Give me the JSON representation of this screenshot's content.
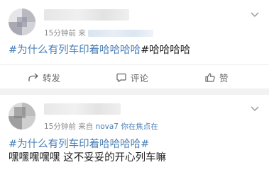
{
  "posts": [
    {
      "time": "15分钟前",
      "source_prefix": "来",
      "content_tag": "#为什么有列车印着哈哈哈哈",
      "content_text": "#哈哈哈哈",
      "actions": {
        "repost_label": "转发",
        "comment_label": "评论",
        "like_label": "赞"
      }
    },
    {
      "time": "15分钟前",
      "source_prefix": "来自",
      "source_device": "nova7 你在焦点在",
      "content_tag": "#为什么有列车印着哈哈哈哈#",
      "content_text": "嘿嘿嘿嘿嘿    这不妥妥的开心列车嘛"
    }
  ],
  "colors": {
    "link_blue": "#4a7fb5",
    "meta_gray": "#8d8d8d",
    "separator": "#f2f2f2"
  },
  "icons": [
    "chevron-down-icon",
    "repost-icon",
    "comment-icon",
    "like-icon"
  ]
}
